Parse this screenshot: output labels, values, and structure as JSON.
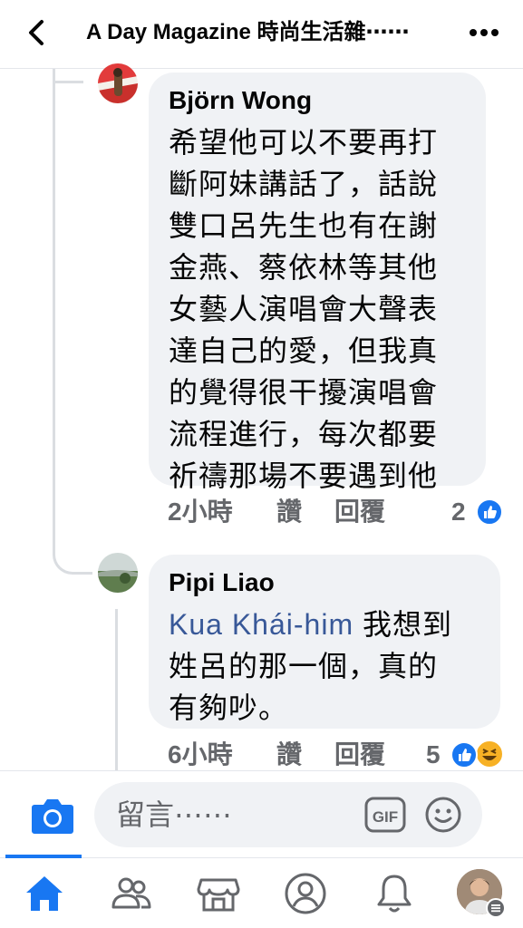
{
  "header": {
    "title": "A Day Magazine 時尚生活雜⋯⋯",
    "back_icon": "chevron-left-icon",
    "more_icon": "more-icon"
  },
  "comments": [
    {
      "author": "Björn Wong",
      "lines": [
        "希望他可以不要再打",
        "斷阿妹講話了，話說",
        "雙口呂先生也有在謝",
        "金燕、蔡依林等其他",
        "女藝人演唱會大聲表",
        "達自己的愛，但我真",
        "的覺得很干擾演唱會",
        "流程進行，每次都要",
        "祈禱那場不要遇到他"
      ],
      "time": "2小時",
      "like_label": "讚",
      "reply_label": "回覆",
      "reaction_count": "2",
      "reactions": [
        "like-icon"
      ]
    },
    {
      "author": "Pipi Liao",
      "mention": "Kua Khái-him",
      "lines": [
        " 我想到",
        "姓呂的那一個，真的",
        "有夠吵。"
      ],
      "time": "6小時",
      "like_label": "讚",
      "reply_label": "回覆",
      "reaction_count": "5",
      "reactions": [
        "like-icon",
        "haha-icon"
      ]
    }
  ],
  "composer": {
    "placeholder": "留言⋯⋯",
    "camera_icon": "camera-icon",
    "gif_label": "GIF",
    "emoji_icon": "smiley-icon"
  },
  "tabs": [
    "home-icon",
    "friends-icon",
    "marketplace-icon",
    "profile-icon",
    "notifications-icon",
    "menu-avatar"
  ],
  "colors": {
    "accent": "#1877f2",
    "bubble": "#f0f2f5",
    "secondary_text": "#65676b",
    "mention": "#385898",
    "haha": "#f7b125"
  }
}
